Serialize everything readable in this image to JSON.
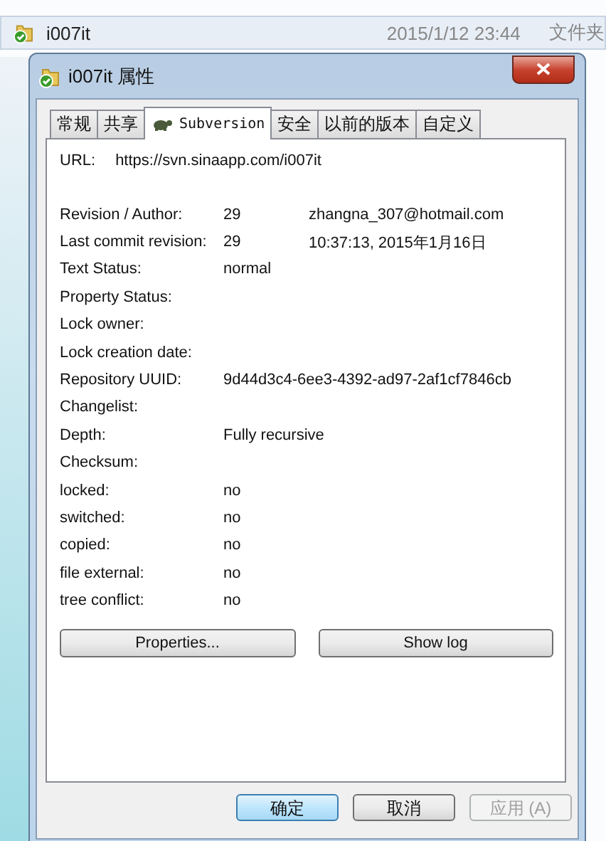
{
  "explorer": {
    "rows": [
      {
        "name": "i007it",
        "date": "2015/1/12 23:44",
        "type": "文件夹",
        "selected": true
      }
    ]
  },
  "dialog": {
    "title": "i007it 属性",
    "tabs": [
      {
        "label": "常规",
        "selected": false,
        "kind": "plain"
      },
      {
        "label": "共享",
        "selected": false,
        "kind": "plain"
      },
      {
        "label": "Subversion",
        "selected": true,
        "kind": "svn"
      },
      {
        "label": "安全",
        "selected": false,
        "kind": "plain"
      },
      {
        "label": "以前的版本",
        "selected": false,
        "kind": "plain"
      },
      {
        "label": "自定义",
        "selected": false,
        "kind": "plain"
      }
    ],
    "url": {
      "label": "URL:",
      "value": "https://svn.sinaapp.com/i007it"
    },
    "properties": [
      {
        "label": "Revision / Author:",
        "value": "29",
        "extra": "zhangna_307@hotmail.com"
      },
      {
        "label": "Last commit revision:",
        "value": "29",
        "extra": "10:37:13, 2015年1月16日"
      },
      {
        "label": "Text Status:",
        "value": "normal"
      },
      {
        "label": "Property Status:"
      },
      {
        "label": "Lock owner:"
      },
      {
        "label": "Lock creation date:"
      },
      {
        "label": "Repository UUID:",
        "value": "9d44d3c4-6ee3-4392-ad97-2af1cf7846cb"
      },
      {
        "label": "Changelist:"
      },
      {
        "label": "Depth:",
        "value": "Fully recursive"
      },
      {
        "label": "Checksum:"
      },
      {
        "label": "locked:",
        "value": "no"
      },
      {
        "label": "switched:",
        "value": "no"
      },
      {
        "label": "copied:",
        "value": "no"
      },
      {
        "label": "file external:",
        "value": "no"
      },
      {
        "label": "tree conflict:",
        "value": "no"
      }
    ],
    "panel_buttons": [
      "Properties...",
      "Show log"
    ],
    "footer_buttons": [
      {
        "label": "确定",
        "default": true,
        "disabled": false
      },
      {
        "label": "取消",
        "default": false,
        "disabled": false
      },
      {
        "label": "应用 (A)",
        "default": false,
        "disabled": true
      }
    ]
  }
}
